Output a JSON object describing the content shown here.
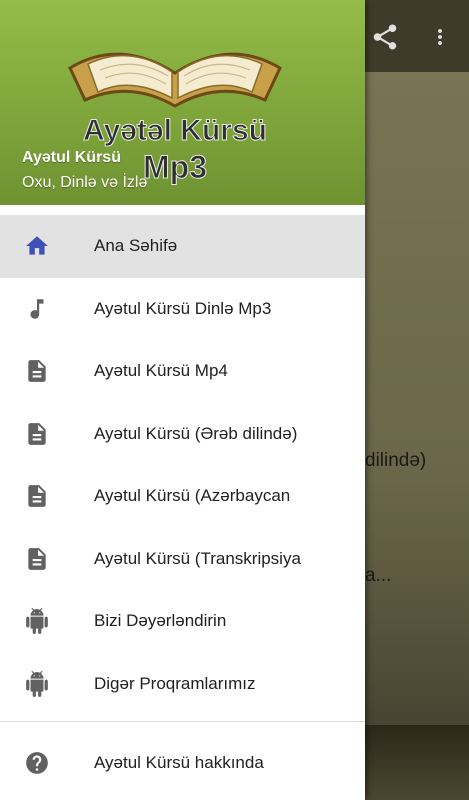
{
  "background": {
    "partial_text_1": "dilində)",
    "partial_text_2": "a...",
    "share_icon": "share-icon",
    "more_icon": "more-vert-icon"
  },
  "drawer": {
    "header": {
      "logo_line1": "Ayətəl Kürsü",
      "logo_line2": "Mp3",
      "title": "Ayətul Kürsü",
      "subtitle": "Oxu, Dinlə və İzlə",
      "background_color": "#86ae3e"
    },
    "items": [
      {
        "label": "Ana Səhifə",
        "icon": "home-icon",
        "selected": true
      },
      {
        "label": "Ayətul Kürsü Dinlə Mp3",
        "icon": "music-note-icon"
      },
      {
        "label": "Ayətul Kürsü Mp4",
        "icon": "document-icon"
      },
      {
        "label": "Ayətul Kürsü (Ərəb dilində)",
        "icon": "document-icon"
      },
      {
        "label": "Ayətul Kürsü (Azərbaycan",
        "icon": "document-icon"
      },
      {
        "label": "Ayətul Kürsü (Transkripsiya",
        "icon": "document-icon"
      },
      {
        "label": "Bizi Dəyərləndirin",
        "icon": "android-icon"
      },
      {
        "label": "Digər Proqramlarımız",
        "icon": "android-icon"
      }
    ],
    "footer_item": {
      "label": "Ayətul Kürsü  hakkında",
      "icon": "help-icon"
    }
  },
  "colors": {
    "accent": "#3f51b5",
    "icon_gray": "#616161"
  }
}
